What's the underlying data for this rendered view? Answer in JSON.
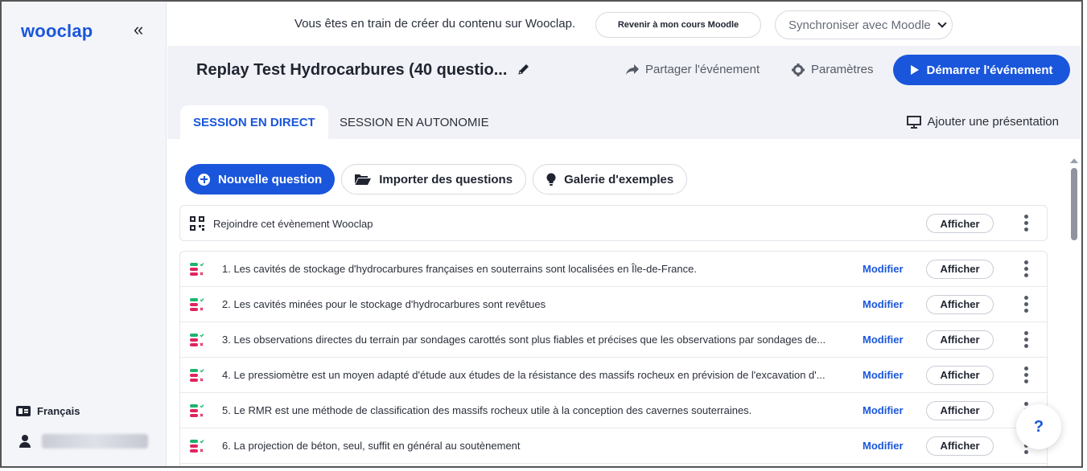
{
  "sidebar": {
    "logo": "wooclap",
    "collapse_icon": "chevron-double-left-icon",
    "language_label": "Français",
    "user_name": ""
  },
  "banner": {
    "text": "Vous êtes en train de créer du contenu sur Wooclap.",
    "moodle_button": "Revenir à mon cours Moodle",
    "sync_select": "Synchroniser avec Moodle"
  },
  "header": {
    "title": "Replay Test Hydrocarbures (40 questio...",
    "share_label": "Partager l'événement",
    "settings_label": "Paramètres",
    "start_label": "Démarrer l'événement"
  },
  "tabs": {
    "live": "SESSION EN DIRECT",
    "self_paced": "SESSION EN AUTONOMIE",
    "add_presentation": "Ajouter une présentation"
  },
  "actions": {
    "new_question": "Nouvelle question",
    "import_questions": "Importer des questions",
    "examples_gallery": "Galerie d'exemples"
  },
  "join_row": {
    "label": "Rejoindre cet évènement Wooclap",
    "show": "Afficher"
  },
  "questions": [
    {
      "text": "1. Les cavités de stockage d'hydrocarbures françaises en souterrains sont localisées en Île-de-France.",
      "modify": "Modifier",
      "show": "Afficher"
    },
    {
      "text": "2. Les cavités minées pour le stockage d'hydrocarbures sont revêtues",
      "modify": "Modifier",
      "show": "Afficher"
    },
    {
      "text": "3. Les observations directes du terrain par sondages carottés sont plus fiables et précises que les observations par sondages de...",
      "modify": "Modifier",
      "show": "Afficher"
    },
    {
      "text": "4. Le pressiomètre est un moyen adapté d'étude aux études de la résistance des massifs rocheux en prévision de l'excavation d'...",
      "modify": "Modifier",
      "show": "Afficher"
    },
    {
      "text": "5. Le RMR est une méthode de classification des massifs rocheux utile à la conception des cavernes souterraines.",
      "modify": "Modifier",
      "show": "Afficher"
    },
    {
      "text": "6. La projection de béton, seul, suffit en général au soutènement",
      "modify": "Modifier",
      "show": "Afficher"
    }
  ],
  "help": "?",
  "colors": {
    "brand": "#1a56db",
    "sidebar_bg": "#f4f5f9",
    "header_bg": "#f1f2f7",
    "icon_red": "#e0245e",
    "icon_green": "#1db36b"
  }
}
